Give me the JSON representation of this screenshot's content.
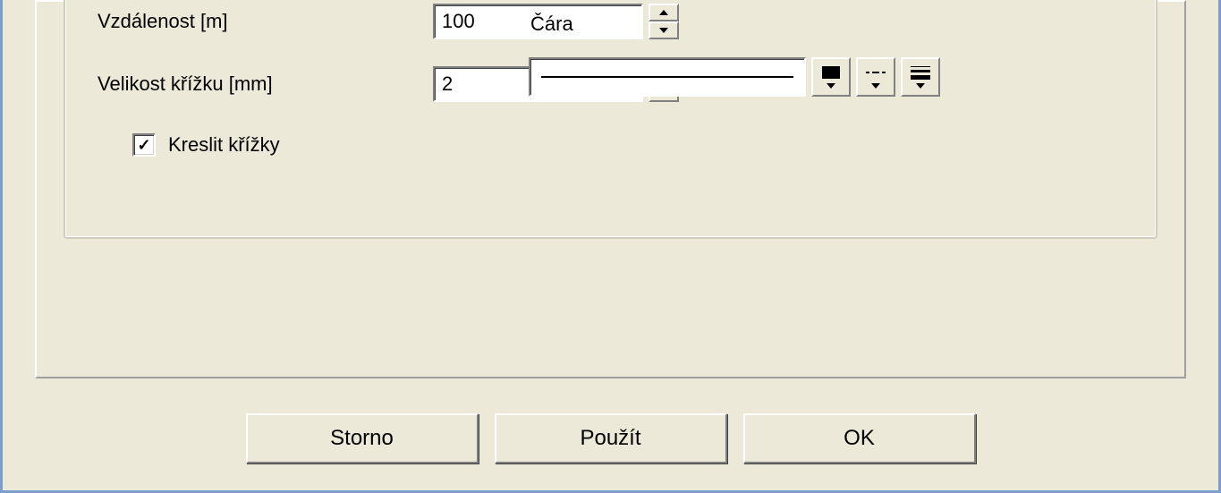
{
  "labels": {
    "distance": "Vzdálenost [m]",
    "cross_size": "Velikost křížku [mm]",
    "line": "Čára",
    "draw_crosses": "Kreslit křížky"
  },
  "values": {
    "distance": "100",
    "cross_size": "2",
    "draw_crosses_checked": true
  },
  "buttons": {
    "cancel": "Storno",
    "apply": "Použít",
    "ok": "OK"
  }
}
